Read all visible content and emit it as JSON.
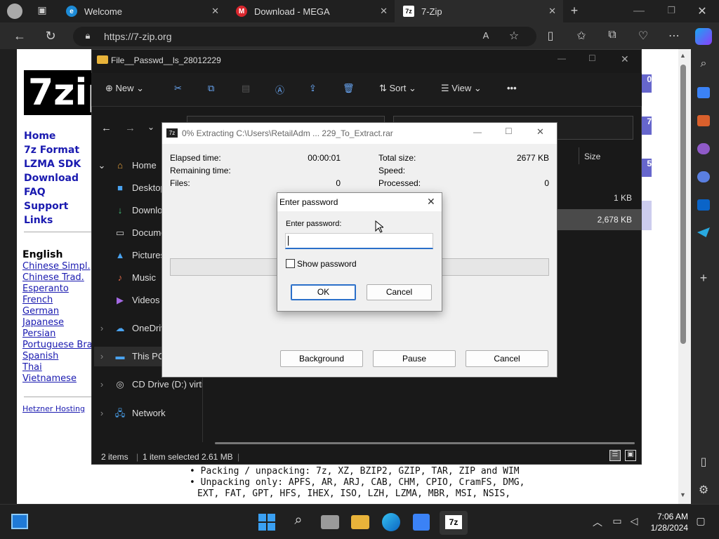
{
  "browser": {
    "tabs": [
      {
        "title": "Welcome",
        "favicon": "edge-icon"
      },
      {
        "title": "Download - MEGA",
        "favicon": "mega-icon"
      },
      {
        "title": "7-Zip",
        "favicon": "7zip-icon"
      }
    ],
    "url": "https://7-zip.org"
  },
  "site": {
    "logo": "7zip",
    "nav": [
      "Home",
      "7z Format",
      "LZMA SDK",
      "Download",
      "FAQ",
      "Support",
      "Links"
    ],
    "lang_heading": "English",
    "languages": [
      "Chinese Simpl.",
      "Chinese Trad.",
      "Esperanto",
      "French",
      "German",
      "Japanese",
      "Persian",
      "Portuguese Bra",
      "Spanish",
      "Thai",
      "Vietnamese"
    ],
    "hosting": "Hetzner Hosting",
    "right_marks": [
      "0",
      "7",
      "5"
    ],
    "bullets": [
      "Packing / unpacking: 7z, XZ, BZIP2, GZIP, TAR, ZIP and WIM",
      "Unpacking only: APFS, AR, ARJ, CAB, CHM, CPIO, CramFS, DMG,",
      "EXT, FAT, GPT, HFS, IHEX, ISO, LZH, LZMA, MBR, MSI, NSIS,"
    ]
  },
  "explorer": {
    "title": "File__Passwd__ls_28012229",
    "toolbar": {
      "new": "New",
      "sort": "Sort",
      "view": "View"
    },
    "nav": [
      "Home",
      "Desktop",
      "Downloads",
      "Documents",
      "Pictures",
      "Music",
      "Videos",
      "OneDrive",
      "This PC",
      "CD Drive (D:) virtio-win",
      "Network"
    ],
    "column_size": "Size",
    "file_sizes": [
      "1 KB",
      "2,678 KB"
    ],
    "status": {
      "items": "2 items",
      "selected": "1 item selected",
      "size": "2.61 MB"
    }
  },
  "extract": {
    "title": "0% Extracting C:\\Users\\RetailAdm ... 229_To_Extract.rar",
    "elapsed_label": "Elapsed time:",
    "elapsed_value": "00:00:01",
    "remaining_label": "Remaining time:",
    "files_label": "Files:",
    "files_value": "0",
    "total_label": "Total size:",
    "total_value": "2677 KB",
    "speed_label": "Speed:",
    "processed_label": "Processed:",
    "processed_value": "0",
    "buttons": {
      "background": "Background",
      "pause": "Pause",
      "cancel": "Cancel"
    }
  },
  "password": {
    "title": "Enter password",
    "label": "Enter password:",
    "value": "",
    "show": "Show password",
    "ok": "OK",
    "cancel": "Cancel"
  },
  "taskbar": {
    "time": "7:06 AM",
    "date": "1/28/2024"
  }
}
